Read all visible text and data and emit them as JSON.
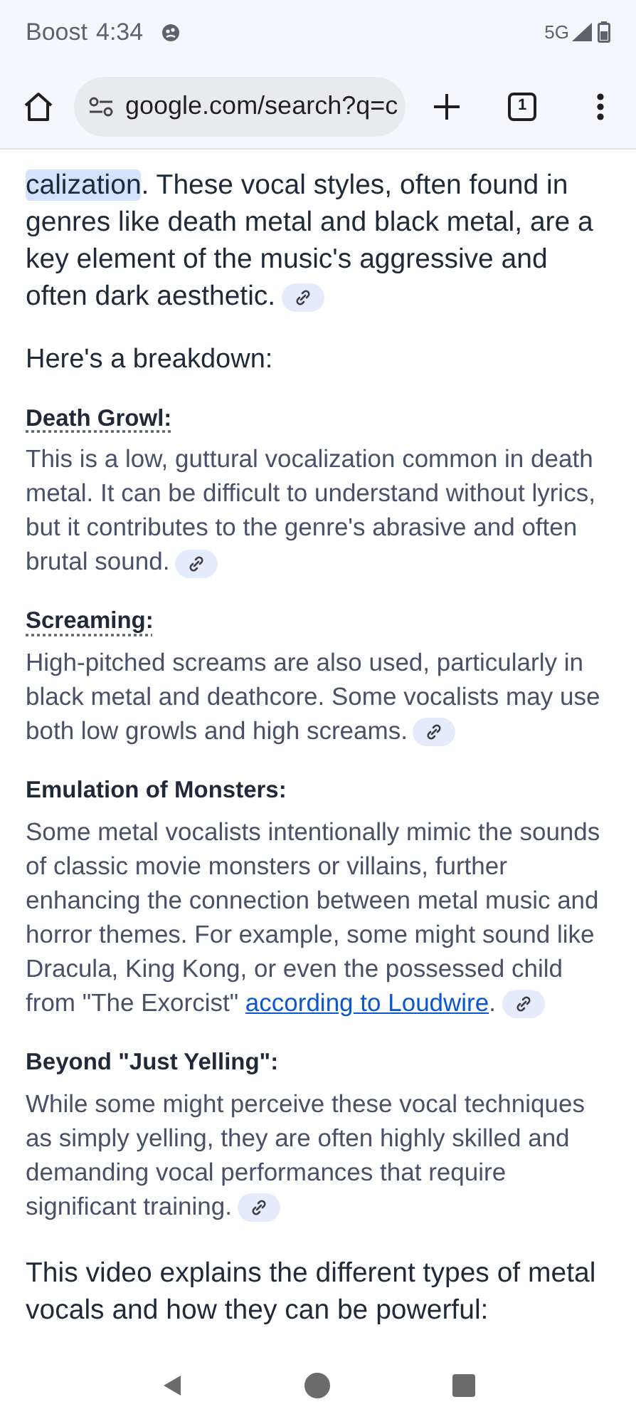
{
  "status_bar": {
    "carrier": "Boost",
    "time": "4:34",
    "network": "5G"
  },
  "toolbar": {
    "url": "google.com/search?q=c",
    "tab_count": "1"
  },
  "intro": {
    "highlighted": "calization",
    "text": ". These vocal styles, often found in genres like death metal and black metal, are a key element of the music's aggressive and often dark aesthetic."
  },
  "heading": "Here's a breakdown:",
  "sections": [
    {
      "title": "Death Growl:",
      "dotted": true,
      "body": "This is a low, guttural vocalization common in death metal. It can be difficult to understand without lyrics, but it contributes to the genre's abrasive and often brutal sound."
    },
    {
      "title": "Screaming:",
      "dotted": true,
      "body": "High-pitched screams are also used, particularly in black metal and deathcore. Some vocalists may use both low growls and high screams."
    },
    {
      "title": "Emulation of Monsters:",
      "dotted": false,
      "body": "Some metal vocalists intentionally mimic the sounds of classic movie monsters or villains, further enhancing the connection between metal music and horror themes. For example, some might sound like Dracula, King Kong, or even the possessed child from \"The Exorcist\"",
      "link": "according to Loudwire",
      "after": "."
    },
    {
      "title": "Beyond \"Just Yelling\":",
      "dotted": false,
      "body": "While some might perceive these vocal techniques as simply yelling, they are often highly skilled and demanding vocal performances that require significant training."
    }
  ],
  "outro": "This video explains the different types of metal vocals and how they can be powerful:"
}
